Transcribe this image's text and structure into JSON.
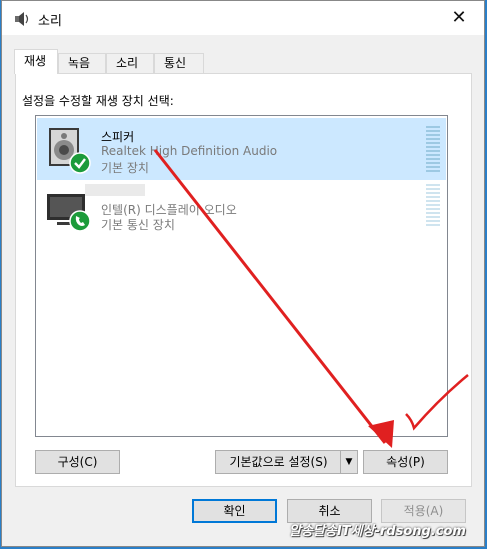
{
  "window": {
    "title": "소리",
    "close_glyph": "✕"
  },
  "tabs": [
    {
      "label": "재생",
      "active": true
    },
    {
      "label": "녹음",
      "active": false
    },
    {
      "label": "소리",
      "active": false
    },
    {
      "label": "통신",
      "active": false
    }
  ],
  "instruction": "설정을 수정할 재생 장치 선택:",
  "devices": [
    {
      "name": "스피커",
      "driver": "Realtek High Definition Audio",
      "status": "기본 장치",
      "icon": "speaker-icon",
      "badge": "check-badge-icon",
      "selected": true
    },
    {
      "name": "인텔(R) 디스플레이 오디오",
      "driver": "",
      "status": "기본 통신 장치",
      "icon": "monitor-icon",
      "badge": "phone-badge-icon",
      "selected": false
    }
  ],
  "buttons": {
    "configure": "구성(C)",
    "set_default": "기본값으로 설정(S)",
    "properties": "속성(P)",
    "ok": "확인",
    "cancel": "취소",
    "apply": "적용(A)"
  },
  "watermark": "알송달송IT세상-rdsong.com",
  "colors": {
    "selection": "#cce8ff",
    "annotation": "#e02020",
    "accent": "#0078d7"
  }
}
